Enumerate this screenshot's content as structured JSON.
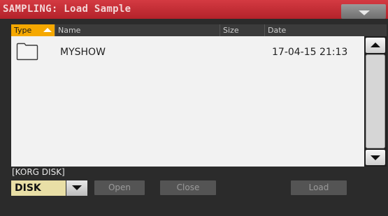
{
  "window": {
    "title": "SAMPLING: Load Sample"
  },
  "header": {
    "columns": {
      "type": "Type",
      "name": "Name",
      "size": "Size",
      "date": "Date"
    }
  },
  "files": [
    {
      "type_icon": "folder-icon",
      "name": "MYSHOW",
      "size": "",
      "date": "17-04-15 21:13"
    }
  ],
  "path_label": "[KORG DISK]",
  "disk": {
    "selected": "DISK"
  },
  "buttons": {
    "open": "Open",
    "close": "Close",
    "load": "Load"
  },
  "colors": {
    "title_bar": "#c52f37",
    "type_header": "#f5a800",
    "disk_selector": "#e9dfa6"
  }
}
